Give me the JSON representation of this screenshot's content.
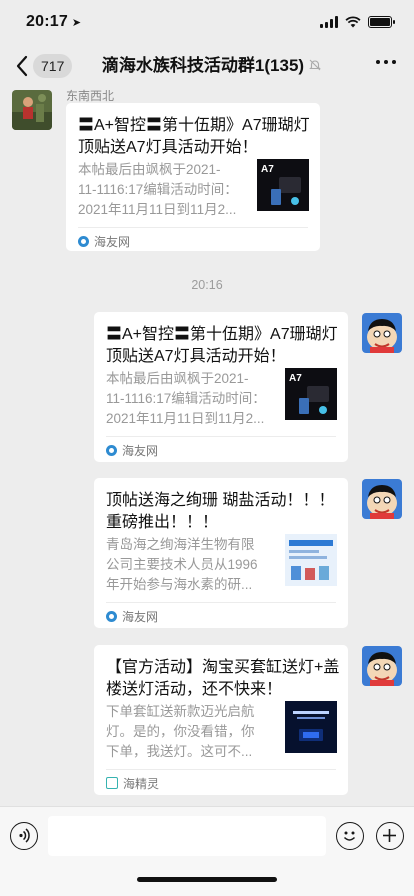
{
  "status": {
    "time": "20:17"
  },
  "nav": {
    "unread_count": "717",
    "title": "滴海水族科技活动群1(135)"
  },
  "first_sender": {
    "name": "东南西北"
  },
  "timestamp": "20:16",
  "messages": [
    {
      "title": "〓A+智控〓第十伍期》A7珊瑚灯顶贴送A7灯具活动开始！",
      "desc": "本帖最后由飒枫于2021-11-1116:17编辑活动时间：2021年11月11日到11月2...",
      "thumb_text": "A7",
      "source": "海友网"
    },
    {
      "title": "〓A+智控〓第十伍期》A7珊瑚灯顶贴送A7灯具活动开始！",
      "desc": "本帖最后由飒枫于2021-11-1116:17编辑活动时间：2021年11月11日到11月2...",
      "thumb_text": "A7",
      "source": "海友网"
    },
    {
      "title": "顶帖送海之绚珊 瑚盐活动！！！ 重磅推出！！！",
      "desc": "青岛海之绚海洋生物有限公司主要技术人员从1996年开始参与海水素的研...",
      "thumb_text": "",
      "source": "海友网"
    },
    {
      "title": "【官方活动】淘宝买套缸送灯+盖楼送灯活动，还不快来！",
      "desc": "下单套缸送新款迈光启航灯。是的，你没看错，你下单，我送灯。这可不...",
      "thumb_text": "",
      "source": "海精灵"
    }
  ],
  "colors": {
    "chat_bg": "#ededed",
    "card_bg": "#ffffff",
    "source_blue": "#2e8bd1",
    "source_teal": "#36b3b0"
  }
}
